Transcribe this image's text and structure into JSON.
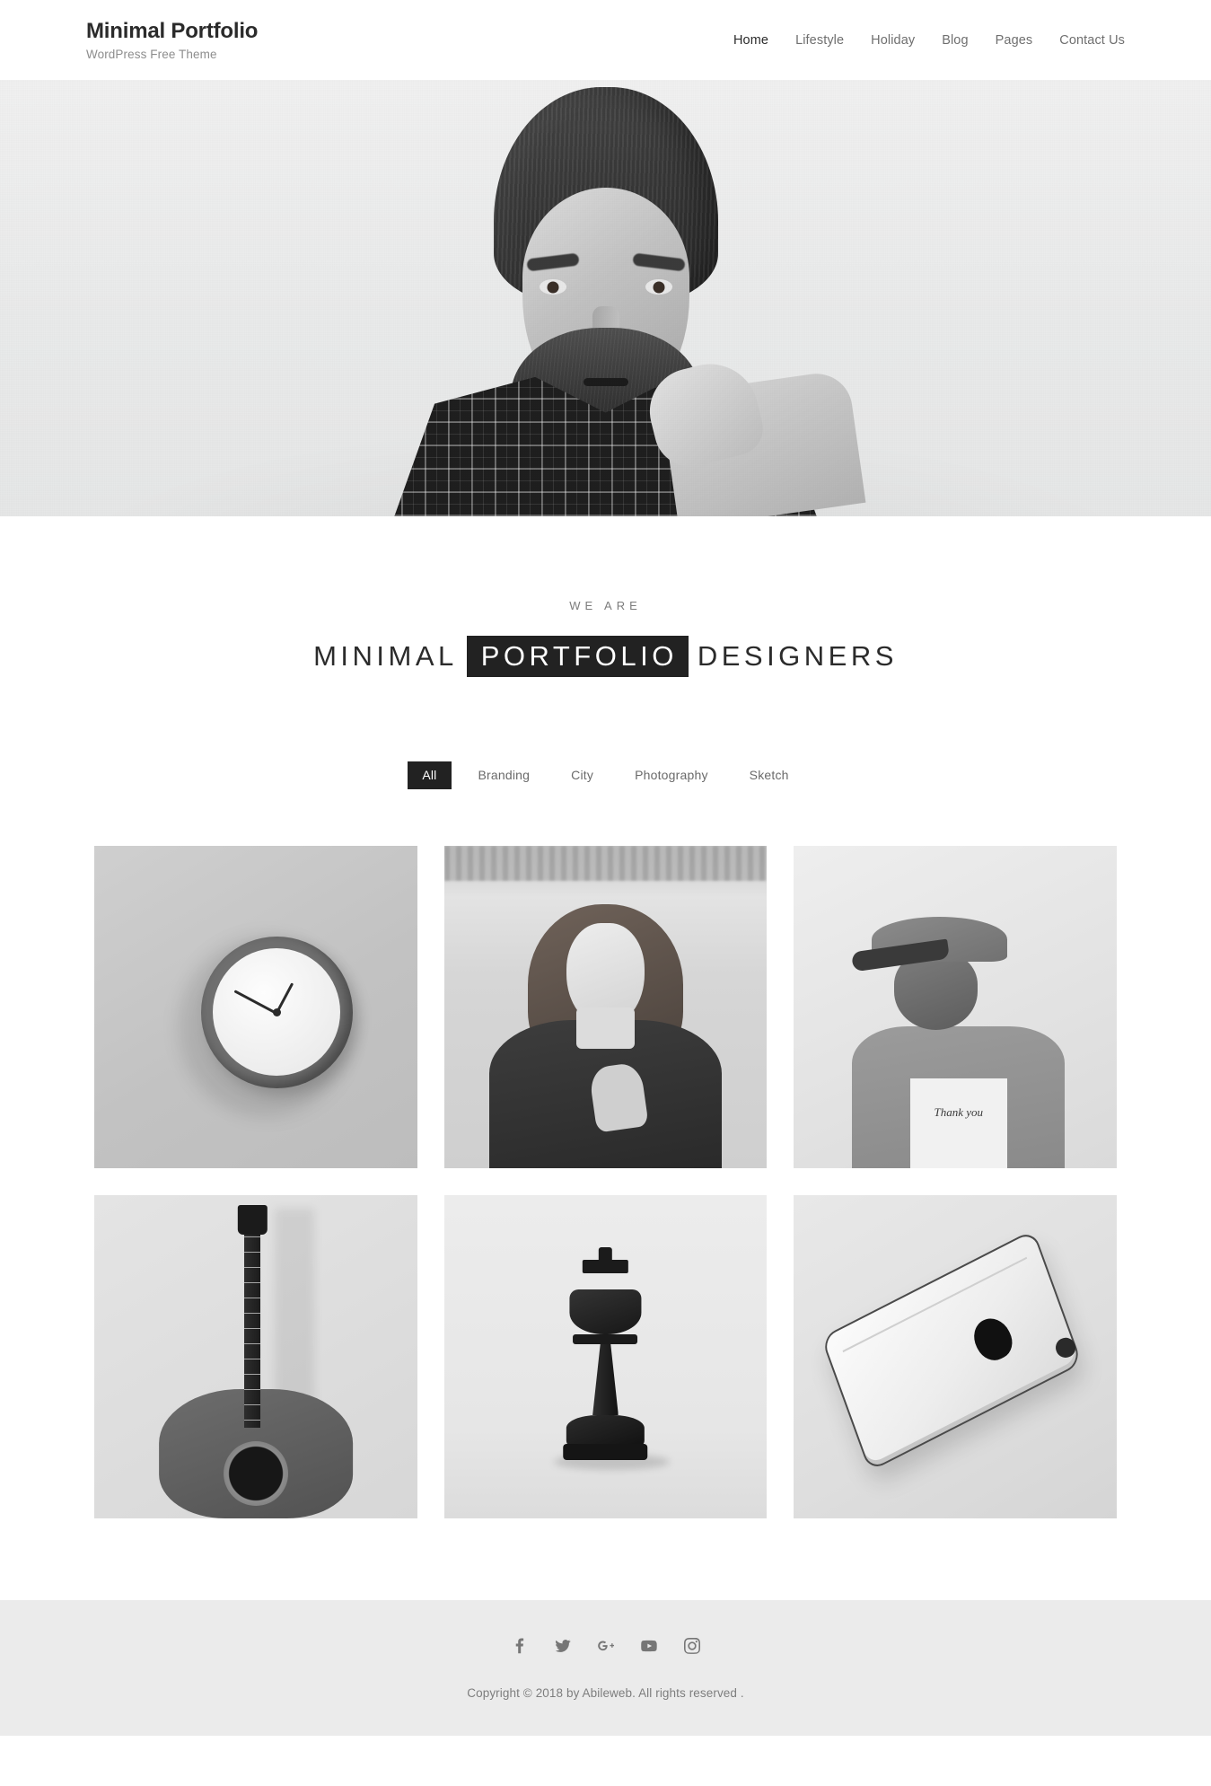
{
  "header": {
    "brand_title": "Minimal Portfolio",
    "brand_tagline": "WordPress Free Theme",
    "nav": [
      {
        "label": "Home",
        "active": true
      },
      {
        "label": "Lifestyle",
        "active": false
      },
      {
        "label": "Holiday",
        "active": false
      },
      {
        "label": "Blog",
        "active": false
      },
      {
        "label": "Pages",
        "active": false
      },
      {
        "label": "Contact Us",
        "active": false
      }
    ]
  },
  "hero": {
    "alt": "black and white portrait of bearded man wearing a knit beanie and plaid shirt",
    "background_color": "#ececec"
  },
  "intro": {
    "eyebrow": "WE ARE",
    "heading_before": "MINIMAL",
    "heading_highlight": "PORTFOLIO",
    "heading_after": "DESIGNERS",
    "highlight_bg": "#222222",
    "highlight_color": "#ffffff"
  },
  "filters": {
    "active_bg": "#222222",
    "items": [
      {
        "label": "All",
        "active": true
      },
      {
        "label": "Branding",
        "active": false
      },
      {
        "label": "City",
        "active": false
      },
      {
        "label": "Photography",
        "active": false
      },
      {
        "label": "Sketch",
        "active": false
      }
    ]
  },
  "portfolio": {
    "items": [
      {
        "name": "wall-clock",
        "alt": "grey wall clock on a white wall"
      },
      {
        "name": "woman-winter-portrait",
        "alt": "smiling woman in winter coat and gloves by a frozen lake"
      },
      {
        "name": "man-with-cap",
        "alt": "man in snapback cap and thank you t-shirt with earphones"
      },
      {
        "name": "acoustic-guitar",
        "alt": "acoustic guitar leaning against a light wall"
      },
      {
        "name": "chess-king",
        "alt": "black chess king piece on a white surface"
      },
      {
        "name": "smartphone",
        "alt": "silver smartphone lying face down on a light surface"
      }
    ],
    "tee_text": "Thank you"
  },
  "footer": {
    "background_color": "#ebebeb",
    "social": [
      {
        "name": "facebook-icon",
        "label": "Facebook"
      },
      {
        "name": "twitter-icon",
        "label": "Twitter"
      },
      {
        "name": "google-plus-icon",
        "label": "Google Plus"
      },
      {
        "name": "youtube-icon",
        "label": "YouTube"
      },
      {
        "name": "instagram-icon",
        "label": "Instagram"
      }
    ],
    "copyright": "Copyright © 2018 by Abileweb. All rights reserved ."
  }
}
